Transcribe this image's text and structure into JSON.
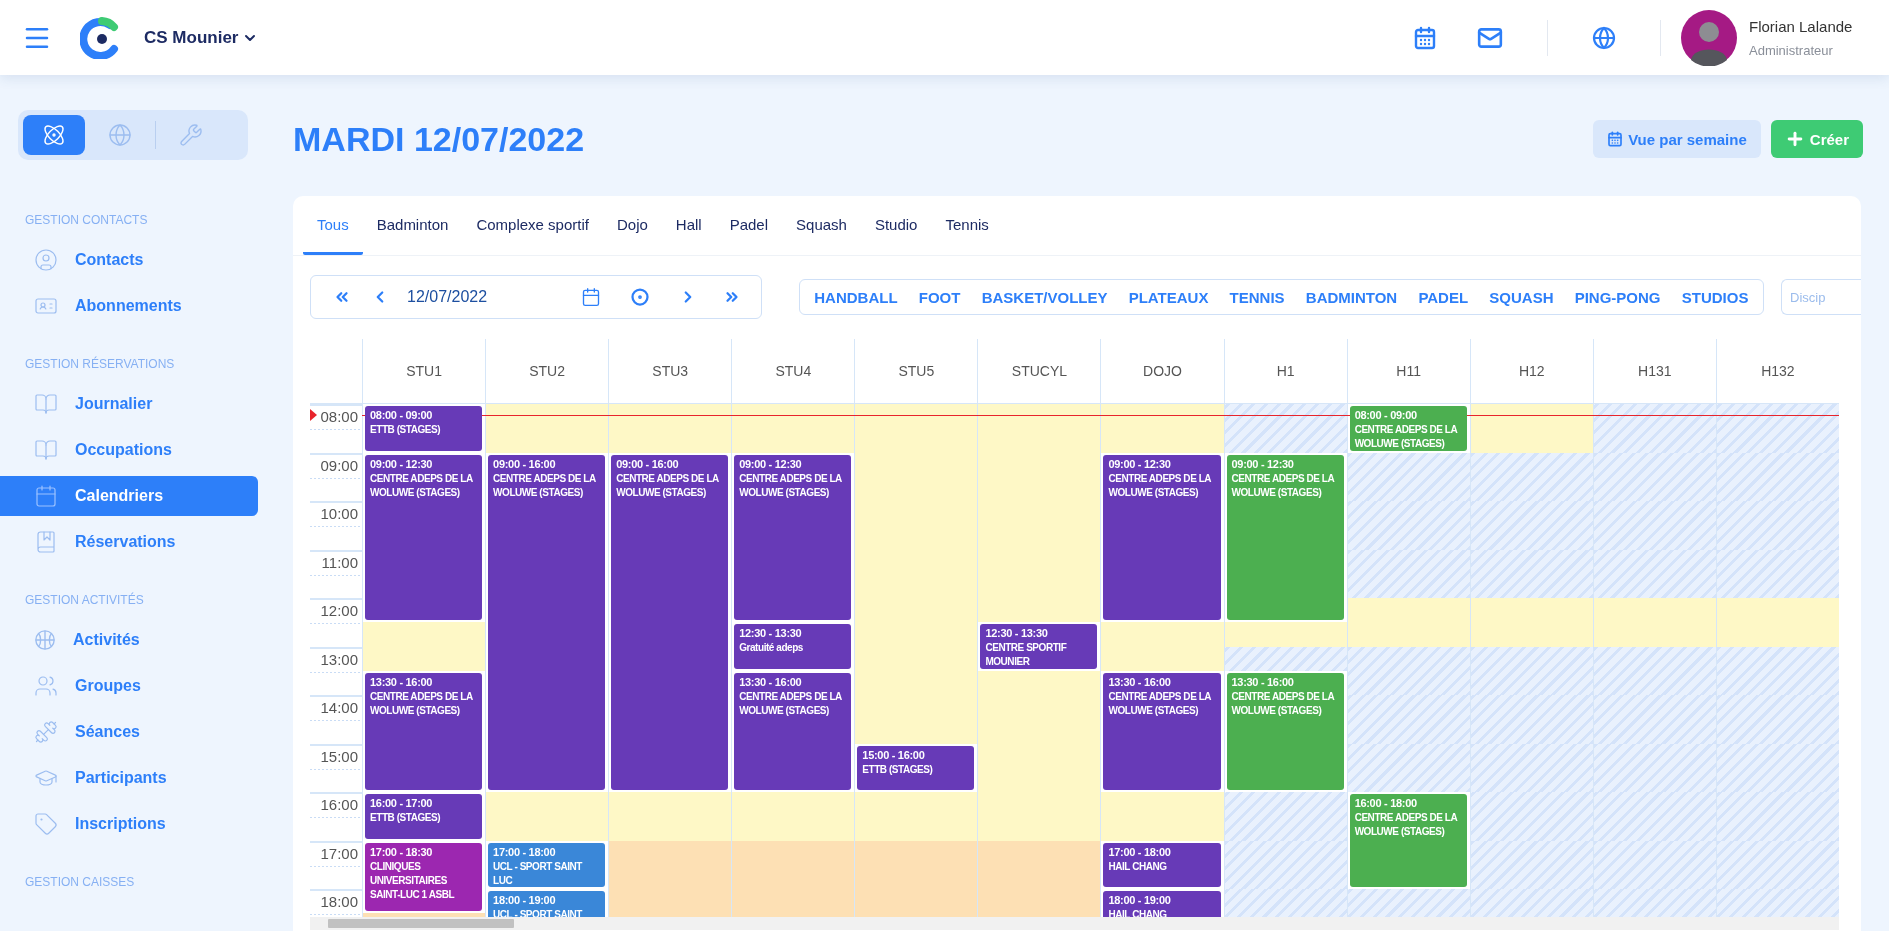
{
  "header": {
    "org": "CS Mounier",
    "user": {
      "name": "Florian Lalande",
      "role": "Administrateur"
    }
  },
  "sidebar": {
    "modes": [
      {
        "selected": true
      },
      {
        "selected": false
      },
      {
        "selected": false
      }
    ],
    "sections": [
      {
        "title": "GESTION CONTACTS",
        "items": [
          {
            "label": "Contacts",
            "selected": false
          },
          {
            "label": "Abonnements",
            "selected": false
          }
        ]
      },
      {
        "title": "GESTION RÉSERVATIONS",
        "items": [
          {
            "label": "Journalier",
            "selected": false
          },
          {
            "label": "Occupations",
            "selected": false
          },
          {
            "label": "Calendriers",
            "selected": true
          },
          {
            "label": "Réservations",
            "selected": false
          }
        ]
      },
      {
        "title": "GESTION ACTIVITÉS",
        "items": [
          {
            "label": "Activités",
            "selected": false
          },
          {
            "label": "Groupes",
            "selected": false
          },
          {
            "label": "Séances",
            "selected": false
          },
          {
            "label": "Participants",
            "selected": false
          },
          {
            "label": "Inscriptions",
            "selected": false
          }
        ]
      },
      {
        "title": "GESTION CAISSES"
      }
    ]
  },
  "page": {
    "title": "MARDI 12/07/2022",
    "buttons": [
      {
        "label": "Vue par semaine",
        "kind": "secondary"
      },
      {
        "label": "Créer",
        "kind": "primary"
      }
    ]
  },
  "calendar": {
    "tabs": [
      {
        "label": "Tous",
        "selected": true
      },
      {
        "label": "Badminton",
        "selected": false
      },
      {
        "label": "Complexe sportif",
        "selected": false
      },
      {
        "label": "Dojo",
        "selected": false
      },
      {
        "label": "Hall",
        "selected": false
      },
      {
        "label": "Padel",
        "selected": false
      },
      {
        "label": "Squash",
        "selected": false
      },
      {
        "label": "Studio",
        "selected": false
      },
      {
        "label": "Tennis",
        "selected": false
      }
    ],
    "navigator": {
      "date": "12/07/2022"
    },
    "categories": [
      "HANDBALL",
      "FOOT",
      "BASKET/VOLLEY",
      "PLATEAUX",
      "TENNIS",
      "BADMINTON",
      "PADEL",
      "SQUASH",
      "PING-PONG",
      "STUDIOS"
    ],
    "discipline_filter": {
      "placeholder": "Discip"
    },
    "slot_hours": [
      "08:00",
      "09:00",
      "10:00",
      "11:00",
      "12:00",
      "13:00",
      "14:00",
      "15:00",
      "16:00",
      "17:00",
      "18:00"
    ],
    "columns": [
      {
        "name": "STU1",
        "slots": [
          {
            "kind": "booked"
          },
          {
            "kind": "booked"
          },
          {
            "kind": "booked"
          },
          {
            "kind": "booked"
          },
          {
            "kind": "open"
          },
          {
            "kind": "open"
          },
          {
            "kind": "booked"
          },
          {
            "kind": "booked"
          },
          {
            "kind": "booked"
          },
          {
            "kind": "booked"
          },
          {
            "kind": "evening"
          }
        ],
        "events": [
          {
            "time": "08:00 - 09:00",
            "title": "ETTB (STAGES)",
            "color": "#673ab7"
          },
          {
            "time": "09:00 - 12:30",
            "title": "CENTRE ADEPS DE LA WOLUWE (STAGES)",
            "color": "#673ab7"
          },
          {
            "time": "13:30 - 16:00",
            "title": "CENTRE ADEPS DE LA WOLUWE (STAGES)",
            "color": "#673ab7"
          },
          {
            "time": "16:00 - 17:00",
            "title": "ETTB (STAGES)",
            "color": "#673ab7"
          },
          {
            "time": "17:00 - 18:30",
            "title": "CLINIQUES UNIVERSITAIRES SAINT-LUC 1 ASBL",
            "color": "#9c27b0"
          }
        ]
      },
      {
        "name": "STU2",
        "slots": [
          {
            "kind": "open"
          },
          {
            "kind": "booked"
          },
          {
            "kind": "booked"
          },
          {
            "kind": "booked"
          },
          {
            "kind": "booked"
          },
          {
            "kind": "booked"
          },
          {
            "kind": "booked"
          },
          {
            "kind": "booked"
          },
          {
            "kind": "open"
          },
          {
            "kind": "booked"
          },
          {
            "kind": "booked"
          }
        ],
        "events": [
          {
            "time": "09:00 - 16:00",
            "title": "CENTRE ADEPS DE LA WOLUWE (STAGES)",
            "color": "#673ab7"
          },
          {
            "time": "17:00 - 18:00",
            "title": "UCL - SPORT SAINT LUC",
            "color": "#3a87d8"
          },
          {
            "time": "18:00 - 19:00",
            "title": "UCL - SPORT SAINT",
            "color": "#3a87d8"
          }
        ]
      },
      {
        "name": "STU3",
        "slots": [
          {
            "kind": "open"
          },
          {
            "kind": "booked"
          },
          {
            "kind": "booked"
          },
          {
            "kind": "booked"
          },
          {
            "kind": "booked"
          },
          {
            "kind": "booked"
          },
          {
            "kind": "booked"
          },
          {
            "kind": "booked"
          },
          {
            "kind": "open"
          },
          {
            "kind": "evening"
          },
          {
            "kind": "evening"
          }
        ],
        "events": [
          {
            "time": "09:00 - 16:00",
            "title": "CENTRE ADEPS DE LA WOLUWE (STAGES)",
            "color": "#673ab7"
          }
        ]
      },
      {
        "name": "STU4",
        "slots": [
          {
            "kind": "open"
          },
          {
            "kind": "booked"
          },
          {
            "kind": "booked"
          },
          {
            "kind": "booked"
          },
          {
            "kind": "booked"
          },
          {
            "kind": "booked"
          },
          {
            "kind": "booked"
          },
          {
            "kind": "booked"
          },
          {
            "kind": "open"
          },
          {
            "kind": "evening"
          },
          {
            "kind": "evening"
          }
        ],
        "events": [
          {
            "time": "09:00 - 12:30",
            "title": "CENTRE ADEPS DE LA WOLUWE (STAGES)",
            "color": "#673ab7"
          },
          {
            "time": "12:30 - 13:30",
            "title": "Gratuité adeps",
            "color": "#673ab7"
          },
          {
            "time": "13:30 - 16:00",
            "title": "CENTRE ADEPS DE LA WOLUWE (STAGES)",
            "color": "#673ab7"
          }
        ]
      },
      {
        "name": "STU5",
        "slots": [
          {
            "kind": "open"
          },
          {
            "kind": "open"
          },
          {
            "kind": "open"
          },
          {
            "kind": "open"
          },
          {
            "kind": "open"
          },
          {
            "kind": "open"
          },
          {
            "kind": "open"
          },
          {
            "kind": "booked"
          },
          {
            "kind": "open"
          },
          {
            "kind": "evening"
          },
          {
            "kind": "evening"
          }
        ],
        "events": [
          {
            "time": "15:00 - 16:00",
            "title": "ETTB (STAGES)",
            "color": "#673ab7"
          }
        ]
      },
      {
        "name": "STUCYL",
        "slots": [
          {
            "kind": "open"
          },
          {
            "kind": "open"
          },
          {
            "kind": "open"
          },
          {
            "kind": "open"
          },
          {
            "kind": "open"
          },
          {
            "kind": "open"
          },
          {
            "kind": "open"
          },
          {
            "kind": "open"
          },
          {
            "kind": "open"
          },
          {
            "kind": "evening"
          },
          {
            "kind": "evening"
          }
        ],
        "events": [
          {
            "time": "12:30 - 13:30",
            "title": "CENTRE SPORTIF MOUNIER",
            "color": "#673ab7"
          }
        ]
      },
      {
        "name": "DOJO",
        "slots": [
          {
            "kind": "open"
          },
          {
            "kind": "booked"
          },
          {
            "kind": "booked"
          },
          {
            "kind": "booked"
          },
          {
            "kind": "open"
          },
          {
            "kind": "open"
          },
          {
            "kind": "booked"
          },
          {
            "kind": "booked"
          },
          {
            "kind": "open"
          },
          {
            "kind": "booked"
          },
          {
            "kind": "booked"
          }
        ],
        "events": [
          {
            "time": "09:00 - 12:30",
            "title": "CENTRE ADEPS DE LA WOLUWE (STAGES)",
            "color": "#673ab7"
          },
          {
            "time": "13:30 - 16:00",
            "title": "CENTRE ADEPS DE LA WOLUWE (STAGES)",
            "color": "#673ab7"
          },
          {
            "time": "17:00 - 18:00",
            "title": "HAIL CHANG",
            "color": "#673ab7"
          },
          {
            "time": "18:00 - 19:00",
            "title": "HAIL CHANG",
            "color": "#673ab7"
          }
        ]
      },
      {
        "name": "H1",
        "slots": [
          {
            "kind": "closed"
          },
          {
            "kind": "booked"
          },
          {
            "kind": "booked"
          },
          {
            "kind": "booked"
          },
          {
            "kind": "open"
          },
          {
            "kind": "closed"
          },
          {
            "kind": "booked"
          },
          {
            "kind": "booked"
          },
          {
            "kind": "closed"
          },
          {
            "kind": "closed"
          },
          {
            "kind": "closed"
          }
        ],
        "events": [
          {
            "time": "09:00 - 12:30",
            "title": "CENTRE ADEPS DE LA WOLUWE (STAGES)",
            "color": "#4caf50"
          },
          {
            "time": "13:30 - 16:00",
            "title": "CENTRE ADEPS DE LA WOLUWE (STAGES)",
            "color": "#4caf50"
          }
        ]
      },
      {
        "name": "H11",
        "slots": [
          {
            "kind": "booked"
          },
          {
            "kind": "closed"
          },
          {
            "kind": "closed"
          },
          {
            "kind": "closed"
          },
          {
            "kind": "open"
          },
          {
            "kind": "closed"
          },
          {
            "kind": "closed"
          },
          {
            "kind": "closed"
          },
          {
            "kind": "booked"
          },
          {
            "kind": "booked"
          },
          {
            "kind": "closed"
          }
        ],
        "events": [
          {
            "time": "08:00 - 09:00",
            "title": "CENTRE ADEPS DE LA WOLUWE (STAGES)",
            "color": "#4caf50"
          },
          {
            "time": "16:00 - 18:00",
            "title": "CENTRE ADEPS DE LA WOLUWE (STAGES)",
            "color": "#4caf50"
          }
        ]
      },
      {
        "name": "H12",
        "slots": [
          {
            "kind": "open"
          },
          {
            "kind": "closed"
          },
          {
            "kind": "closed"
          },
          {
            "kind": "closed"
          },
          {
            "kind": "open"
          },
          {
            "kind": "closed"
          },
          {
            "kind": "closed"
          },
          {
            "kind": "closed"
          },
          {
            "kind": "closed"
          },
          {
            "kind": "closed"
          },
          {
            "kind": "closed"
          }
        ]
      },
      {
        "name": "H131",
        "slots": [
          {
            "kind": "closed"
          },
          {
            "kind": "closed"
          },
          {
            "kind": "closed"
          },
          {
            "kind": "closed"
          },
          {
            "kind": "open"
          },
          {
            "kind": "closed"
          },
          {
            "kind": "closed"
          },
          {
            "kind": "closed"
          },
          {
            "kind": "closed"
          },
          {
            "kind": "closed"
          },
          {
            "kind": "closed"
          }
        ]
      },
      {
        "name": "H132",
        "slots": [
          {
            "kind": "closed"
          },
          {
            "kind": "closed"
          },
          {
            "kind": "closed"
          },
          {
            "kind": "closed"
          },
          {
            "kind": "open"
          },
          {
            "kind": "closed"
          },
          {
            "kind": "closed"
          },
          {
            "kind": "closed"
          },
          {
            "kind": "closed"
          },
          {
            "kind": "closed"
          },
          {
            "kind": "closed"
          }
        ]
      }
    ]
  }
}
